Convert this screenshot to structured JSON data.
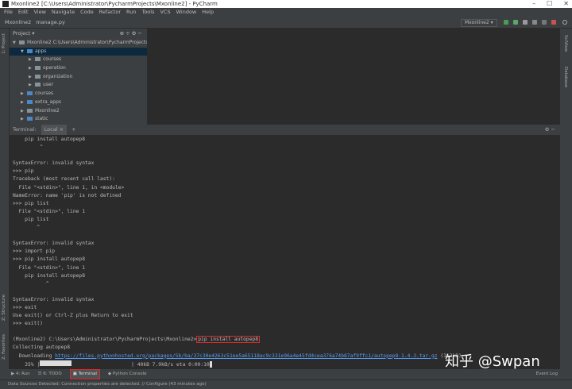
{
  "window": {
    "title": "Mxonline2 [C:\\Users\\Administrator\\PycharmProjects\\Mxonline2] - PyCharm",
    "controls": [
      "–",
      "☐",
      "✕"
    ]
  },
  "menu": [
    "File",
    "Edit",
    "View",
    "Navigate",
    "Code",
    "Refactor",
    "Run",
    "Tools",
    "VCS",
    "Window",
    "Help"
  ],
  "nav": {
    "project": "Mxonline2",
    "file": "manage.py",
    "run_config": "Mxonline2 ▾"
  },
  "left_stripe": {
    "project": "1: Project",
    "structure": "Z: Structure",
    "favorites": "2: Favorites"
  },
  "right_stripe": {
    "scitools": "SciView",
    "database": "Database"
  },
  "project_panel": {
    "title": "Project ▾",
    "icons": "⊕ ÷ ⚙ −",
    "tree": [
      {
        "label": "Mxonline2  C:\\Users\\Administrator\\PycharmProjects\\Mxonline2",
        "depth": 0,
        "open": true
      },
      {
        "label": "apps",
        "depth": 1,
        "open": true,
        "selected": true
      },
      {
        "label": "courses",
        "depth": 2
      },
      {
        "label": "operation",
        "depth": 2
      },
      {
        "label": "organization",
        "depth": 2
      },
      {
        "label": "user",
        "depth": 2
      },
      {
        "label": "courses",
        "depth": 1
      },
      {
        "label": "extra_apps",
        "depth": 1
      },
      {
        "label": "Mxonline2",
        "depth": 1
      },
      {
        "label": "static",
        "depth": 1
      }
    ]
  },
  "terminal": {
    "header": "Terminal:",
    "tab": "Local",
    "tab_close": "×",
    "add": "+",
    "controls": "⚙ −",
    "lines": [
      "    pip install autopep8",
      "         ^",
      "",
      "SyntaxError: invalid syntax",
      ">>> pip",
      "Traceback (most recent call last):",
      "  File \"<stdin>\", line 1, in <module>",
      "NameError: name 'pip' is not defined",
      ">>> pip list",
      "  File \"<stdin>\", line 1",
      "    pip list",
      "        ^",
      "",
      "SyntaxError: invalid syntax",
      ">>> import pip",
      ">>> pip install autopep8",
      "  File \"<stdin>\", line 1",
      "    pip install autopep8",
      "           ^",
      "",
      "SyntaxError: invalid syntax",
      ">>> exit",
      "Use exit() or Ctrl-Z plus Return to exit",
      ">>> exit()",
      ""
    ],
    "prompt": "(Mxonline2) C:\\Users\\Administrator\\PycharmProjects\\Mxonline2>",
    "command": "pip install autopep8",
    "collecting": "Collecting autopep8",
    "downloading_label": "  Downloading ",
    "url": "https://files.pythonhosted.org/packages/5b/ba/37c30e4263c51ee5a65118ac9c331e96a4e45fd4cea376a74b87af9ffc1/autopep8-1.4.3.tar.gz",
    "size": " (113kB)",
    "progress_percent": "    35% |",
    "progress_fraction": 0.35,
    "progress_tail": "| 40kB 7.9kB/s eta 0:00:10"
  },
  "bottom_tabs": [
    {
      "label": "▶ 4: Run"
    },
    {
      "label": "☰ 6: TODO"
    },
    {
      "label": "▣ Terminal",
      "active": true
    },
    {
      "label": "◆ Python Console"
    }
  ],
  "event_log": "Event Log",
  "status": "Data Sources Detected: Connection properties are detected. // Configure (43 minutes ago)",
  "watermark": "知乎 @Swpan"
}
